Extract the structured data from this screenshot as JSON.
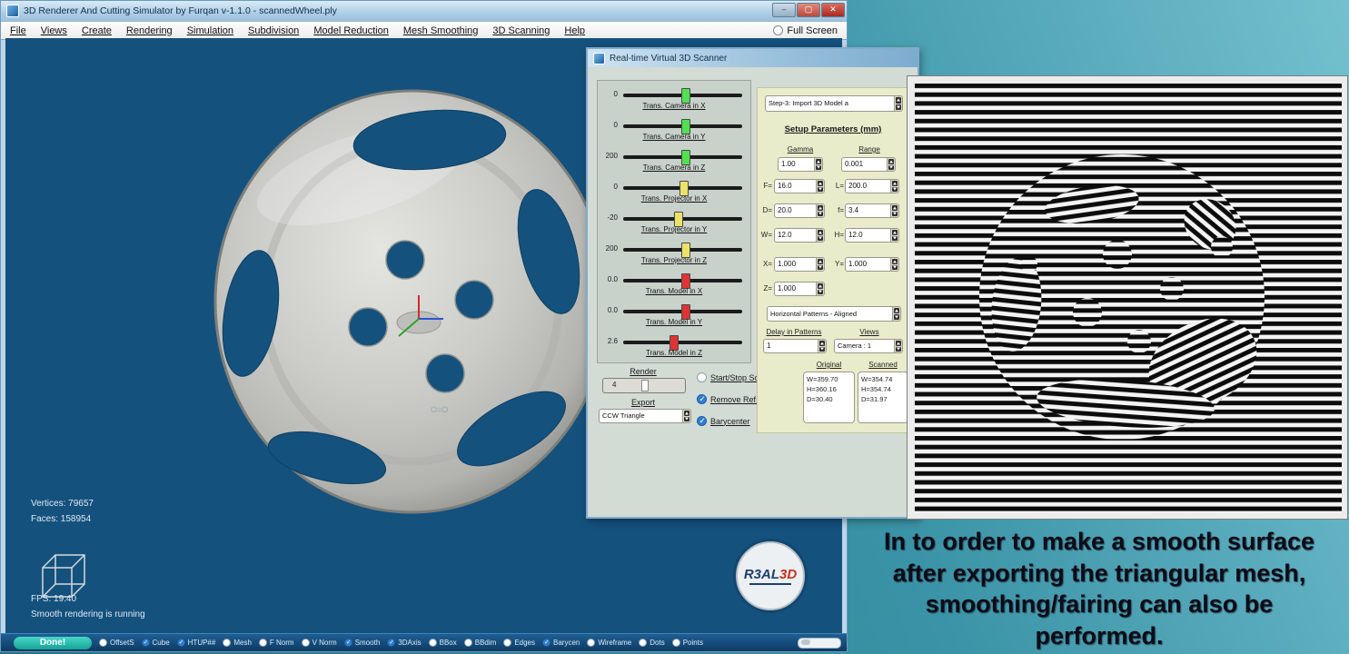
{
  "win": {
    "title": "3D Renderer And Cutting Simulator by Furqan v-1.1.0 - scannedWheel.ply",
    "menu": [
      "File",
      "Views",
      "Create",
      "Rendering",
      "Simulation",
      "Subdivision",
      "Model Reduction",
      "Mesh Smoothing",
      "3D Scanning",
      "Help"
    ],
    "full_screen": "Full Screen"
  },
  "vp": {
    "vertices": "Vertices: 79657",
    "faces": "Faces: 158954",
    "fps": "FPS: 19.40",
    "status": "Smooth rendering is running",
    "annotation": "O=O",
    "logo_main": "R3AL",
    "logo_sub": "3D"
  },
  "dlg": {
    "title": "Real-time Virtual 3D Scanner",
    "sliders": [
      {
        "value": "0",
        "label": "Trans. Camera in X",
        "color": "#52e052"
      },
      {
        "value": "0",
        "label": "Trans. Camera in Y",
        "color": "#52e052"
      },
      {
        "value": "200",
        "label": "Trans. Camera in Z",
        "color": "#52e052"
      },
      {
        "value": "0",
        "label": "Trans. Projector in X",
        "color": "#ece268"
      },
      {
        "value": "-20",
        "label": "Trans. Projector in Y",
        "color": "#ece268"
      },
      {
        "value": "200",
        "label": "Trans. Projector in Z",
        "color": "#ece268"
      },
      {
        "value": "0.0",
        "label": "Trans. Model in X",
        "color": "#e03434"
      },
      {
        "value": "0.0",
        "label": "Trans. Model in Y",
        "color": "#e03434"
      },
      {
        "value": "2.6",
        "label": "Trans. Model in Z",
        "color": "#e03434"
      }
    ],
    "render_label": "Render",
    "render_value": "4",
    "export_label": "Export",
    "export_value": "CCW Triangle",
    "checks": [
      {
        "label": "Start/Stop Scanning",
        "checked": false
      },
      {
        "label": "Remove Ref. Plane",
        "checked": true
      },
      {
        "label": "Barycenter",
        "checked": true
      }
    ],
    "step_dropdown": "Step-3: Import 3D Model a",
    "setup_header": "Setup Parameters (mm)",
    "gamma_label": "Gamma",
    "range_label": "Range",
    "gamma_value": "1.00",
    "range_value": "0.001",
    "params": [
      {
        "k": "F=",
        "v": "16.0"
      },
      {
        "k": "L=",
        "v": "200.0"
      },
      {
        "k": "D=",
        "v": "20.0"
      },
      {
        "k": "f=",
        "v": "3.4"
      },
      {
        "k": "W=",
        "v": "12.0"
      },
      {
        "k": "H=",
        "v": "12.0"
      },
      {
        "k": "X=",
        "v": "1.000"
      },
      {
        "k": "Y=",
        "v": "1.000"
      },
      {
        "k": "Z=",
        "v": "1.000"
      }
    ],
    "pattern_dropdown": "Horizontal Patterns - Aligned",
    "delay_label": "Delay in Patterns",
    "delay_value": "1",
    "views_label": "Views",
    "views_value": "Camera : 1",
    "original": {
      "label": "Original",
      "l1": "W=359.70",
      "l2": "H=360.16",
      "l3": "D=30.40"
    },
    "scanned": {
      "label": "Scanned",
      "l1": "W=354.74",
      "l2": "H=354.74",
      "l3": "D=31.97"
    }
  },
  "bar": {
    "done": "Done!",
    "items": [
      {
        "label": "OffsetS",
        "checked": false
      },
      {
        "label": "Cube",
        "checked": true
      },
      {
        "label": "HTUP##",
        "checked": true
      },
      {
        "label": "Mesh",
        "checked": false
      },
      {
        "label": "F Norm",
        "checked": false
      },
      {
        "label": "V Norm",
        "checked": false
      },
      {
        "label": "Smooth",
        "checked": true
      },
      {
        "label": "3DAxis",
        "checked": true
      },
      {
        "label": "BBox",
        "checked": false
      },
      {
        "label": "BBdim",
        "checked": false
      },
      {
        "label": "Edges",
        "checked": false
      },
      {
        "label": "Barycen",
        "checked": true
      },
      {
        "label": "Wireframe",
        "checked": false
      },
      {
        "label": "Dots",
        "checked": false
      },
      {
        "label": "Points",
        "checked": false
      }
    ]
  },
  "caption": {
    "lines": [
      "In to order to make a smooth surface",
      "after exporting the triangular mesh,",
      "smoothing/fairing can also be",
      "performed."
    ]
  },
  "colors": {
    "check_blue": "#2f7fd0",
    "done_teal": "#2bb8ad",
    "viewport_blue": "#15517d",
    "slider_green": "#52e052",
    "slider_yellow": "#ece268",
    "slider_red": "#e03434"
  }
}
